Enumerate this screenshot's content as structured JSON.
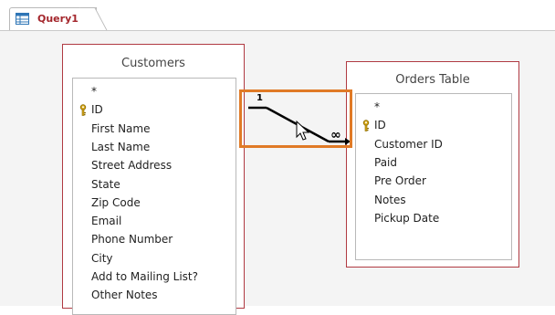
{
  "tab": {
    "label": "Query1",
    "icon": "query-icon"
  },
  "customers": {
    "title": "Customers",
    "fields": [
      {
        "name": "*",
        "key": false
      },
      {
        "name": "ID",
        "key": true
      },
      {
        "name": "First Name",
        "key": false
      },
      {
        "name": "Last Name",
        "key": false
      },
      {
        "name": "Street Address",
        "key": false
      },
      {
        "name": "State",
        "key": false
      },
      {
        "name": "Zip Code",
        "key": false
      },
      {
        "name": "Email",
        "key": false
      },
      {
        "name": "Phone Number",
        "key": false
      },
      {
        "name": "City",
        "key": false
      },
      {
        "name": "Add to Mailing List?",
        "key": false
      },
      {
        "name": "Other Notes",
        "key": false
      }
    ]
  },
  "orders": {
    "title": "Orders Table",
    "fields": [
      {
        "name": "*",
        "key": false
      },
      {
        "name": "ID",
        "key": true
      },
      {
        "name": "Customer ID",
        "key": false
      },
      {
        "name": "Paid",
        "key": false
      },
      {
        "name": "Pre Order",
        "key": false
      },
      {
        "name": "Notes",
        "key": false
      },
      {
        "name": "Pickup Date",
        "key": false
      }
    ]
  },
  "relationship": {
    "one_label": "1",
    "many_label": "∞"
  },
  "colors": {
    "accent": "#e07a26",
    "table_border": "#b03a42",
    "tab_text": "#a4262c"
  }
}
